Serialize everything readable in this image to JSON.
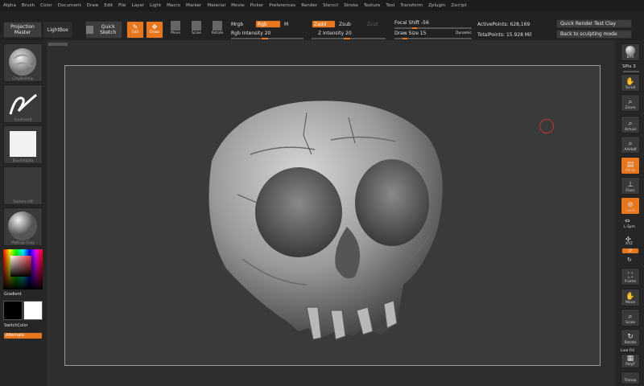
{
  "menu": [
    "Alpha",
    "Brush",
    "Color",
    "Document",
    "Draw",
    "Edit",
    "File",
    "Layer",
    "Light",
    "Macro",
    "Marker",
    "Material",
    "Movie",
    "Picker",
    "Preferences",
    "Render",
    "Stencil",
    "Stroke",
    "Texture",
    "Tool",
    "Transform",
    "Zplugin",
    "Zscript"
  ],
  "toolbar": {
    "projection_master": "Projection Master",
    "lightbox": "LightBox",
    "quick_sketch": "Quick Sketch",
    "edit": "Edit",
    "draw": "Draw",
    "move": "Move",
    "scale": "Scale",
    "rotate": "Rotate",
    "mrgb": "Mrgb",
    "rgb": "Rgb",
    "m": "M",
    "rgb_intensity": "Rgb Intensity 20",
    "rgb_intensity_value": 20,
    "zadd": "Zadd",
    "zsub": "Zsub",
    "zcut": "Zcut",
    "z_intensity": "Z Intensity 20",
    "z_intensity_value": 20,
    "focal_shift": "Focal Shift -56",
    "focal_shift_value": -56,
    "draw_size": "Draw Size 15",
    "draw_size_value": 15,
    "dynamic": "Dynamic",
    "active_points": "ActivePoints: 628,169",
    "total_points": "TotalPoints: 15.928 Mil",
    "quick_render": "Quick Render Test Clay",
    "back_to_sculpt": "Back to sculpting mode"
  },
  "left_tray": {
    "brush": "ClayBuildup",
    "stroke": "FreeHand",
    "alpha": "BrushAlpha",
    "texture": "Texture Off",
    "material": "MatCap Gray",
    "gradient": "Gradient",
    "switch_color": "SwitchColor",
    "alternate": "Alternate"
  },
  "right_tray": {
    "bpr": "BPR",
    "spix": "SPix 3",
    "scroll": "Scroll",
    "zoom": "Zoom",
    "actual": "Actual",
    "aahalf": "AAHalf",
    "persp": "Persp",
    "floor": "Floor",
    "local": "Local",
    "lsym": "L.Sym",
    "xyz": "XYZ",
    "frame": "Frame",
    "move": "Move",
    "scale": "Scale",
    "rotate": "Rotate",
    "line_fill": "Line Fill",
    "polyf": "PolyF",
    "transp": "Transp"
  },
  "colors": {
    "accent": "#e8761c",
    "ui_bg": "#262626",
    "canvas_bg": "#3a3a3a"
  }
}
